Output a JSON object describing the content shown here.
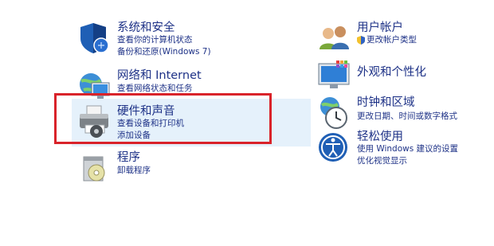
{
  "categories": {
    "system": {
      "title": "系统和安全",
      "links": [
        "查看你的计算机状态",
        "备份和还原(Windows 7)"
      ],
      "icon": "shield-icon"
    },
    "network": {
      "title": "网络和 Internet",
      "links": [
        "查看网络状态和任务"
      ],
      "icon": "network-globe-icon"
    },
    "hardware": {
      "title": "硬件和声音",
      "links": [
        "查看设备和打印机",
        "添加设备"
      ],
      "icon": "printer-icon"
    },
    "programs": {
      "title": "程序",
      "links": [
        "卸载程序"
      ],
      "icon": "programs-disc-icon"
    },
    "users": {
      "title": "用户帐户",
      "links": [
        "更改帐户类型"
      ],
      "icon": "users-icon"
    },
    "appearance": {
      "title": "外观和个性化",
      "links": [],
      "icon": "monitor-palette-icon"
    },
    "clock": {
      "title": "时钟和区域",
      "links": [
        "更改日期、时间或数字格式"
      ],
      "icon": "clock-globe-icon"
    },
    "ease": {
      "title": "轻松使用",
      "links": [
        "使用 Windows 建议的设置",
        "优化视觉显示"
      ],
      "icon": "ease-of-access-icon"
    }
  },
  "colors": {
    "link": "#1e3287",
    "highlight": "#e5f1fb",
    "annotation": "#d9232a"
  }
}
